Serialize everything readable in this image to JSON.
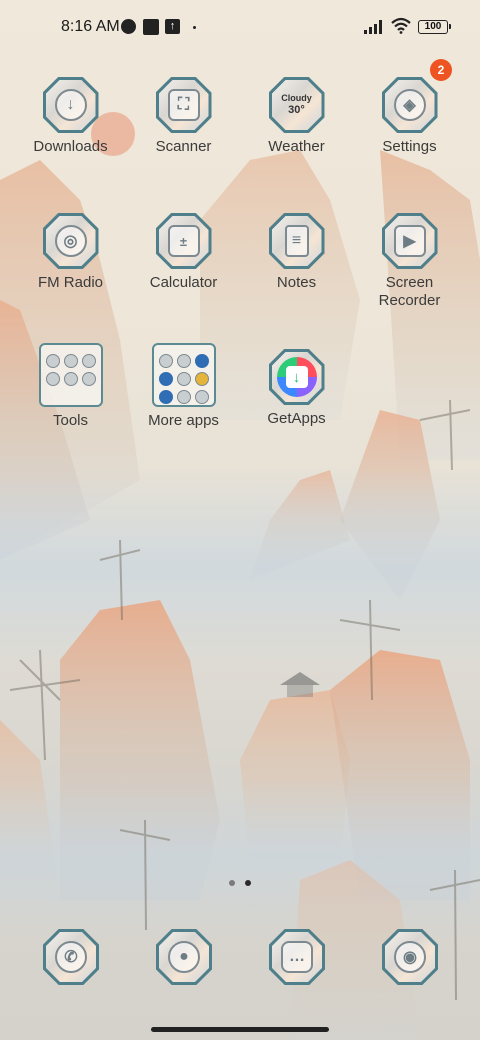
{
  "status_bar": {
    "time": "8:16 AM",
    "battery": "100",
    "notification_icons": [
      "moon-pie-icon",
      "square-icon",
      "upload-box-icon",
      "dot-icon"
    ],
    "extra_icon_label": "↑"
  },
  "apps": [
    {
      "label": "Downloads",
      "icon": "download-icon"
    },
    {
      "label": "Scanner",
      "icon": "scanner-icon"
    },
    {
      "label": "Weather",
      "icon": "weather-icon",
      "weather_text": "Cloudy",
      "weather_temp": "30°"
    },
    {
      "label": "Settings",
      "icon": "settings-icon",
      "badge": "2"
    },
    {
      "label": "FM Radio",
      "icon": "radio-icon"
    },
    {
      "label": "Calculator",
      "icon": "calculator-icon"
    },
    {
      "label": "Notes",
      "icon": "notes-icon"
    },
    {
      "label": "Screen Recorder",
      "icon": "video-camera-icon"
    },
    {
      "label": "Tools",
      "icon": "folder-icon"
    },
    {
      "label": "More apps",
      "icon": "folder-icon"
    },
    {
      "label": "GetApps",
      "icon": "getapps-icon"
    }
  ],
  "dock": [
    {
      "name": "Phone",
      "icon": "phone-icon"
    },
    {
      "name": "Contacts",
      "icon": "contacts-icon"
    },
    {
      "name": "Messages",
      "icon": "messages-icon"
    },
    {
      "name": "Camera",
      "icon": "camera-icon"
    }
  ],
  "page_indicator": {
    "pages": 2,
    "current": 2
  },
  "colors": {
    "badge": "#ee5422",
    "icon_frame": "#4f7f8a"
  }
}
